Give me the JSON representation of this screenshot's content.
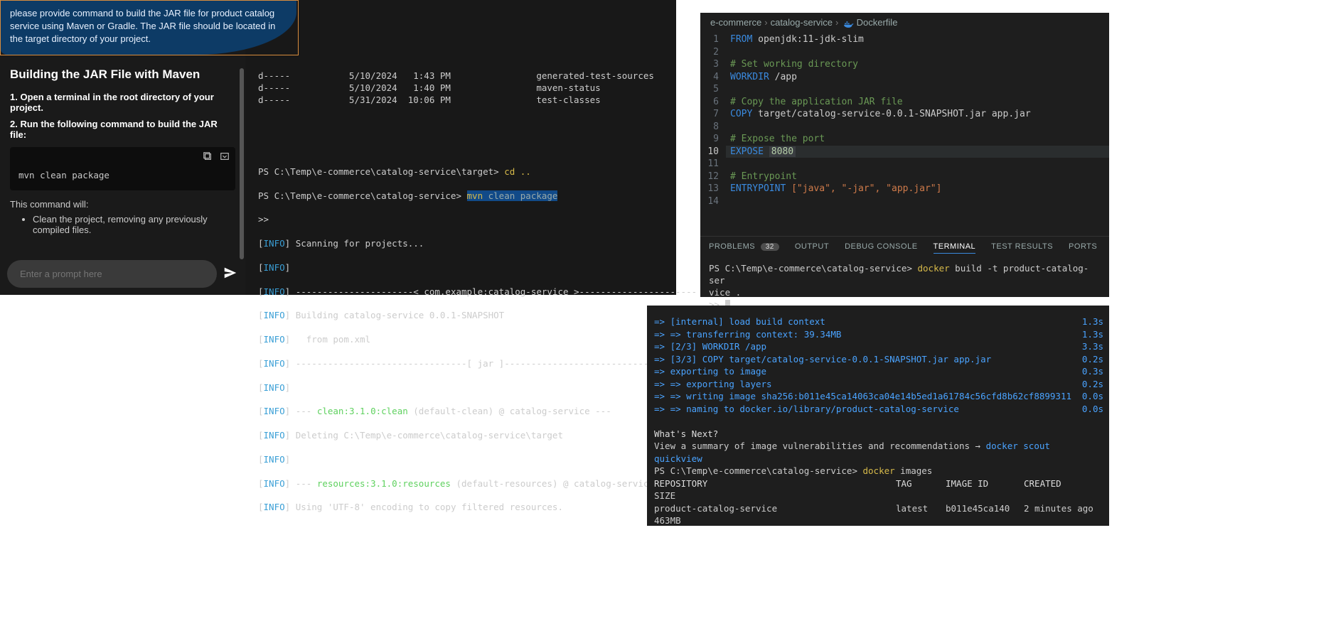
{
  "chat": {
    "callout": "please provide command to build the JAR file for product catalog service using Maven or Gradle. The JAR file should be located in the target directory of your project.",
    "heading": "Building the JAR File with Maven",
    "step1": "1. Open a terminal in the root directory of your project.",
    "step2": "2. Run the following command to build the JAR file:",
    "code": "mvn clean package",
    "will": "This command will:",
    "bullet1": "Clean the project, removing any previously compiled files.",
    "placeholder": "Enter a prompt here"
  },
  "term1": {
    "dir_listing": [
      {
        "mode": "d-----",
        "date": "5/10/2024",
        "time": "1:43 PM",
        "name": "generated-test-sources"
      },
      {
        "mode": "d-----",
        "date": "5/10/2024",
        "time": "1:40 PM",
        "name": "maven-status"
      },
      {
        "mode": "d-----",
        "date": "5/31/2024",
        "time": "10:06 PM",
        "name": "test-classes"
      }
    ],
    "ps1_path": "PS C:\\Temp\\e-commerce\\catalog-service\\target>",
    "cmd1": "cd ..",
    "ps2_path": "PS C:\\Temp\\e-commerce\\catalog-service>",
    "cmd2": "mvn clean package",
    "chev": ">>",
    "l_scan": "Scanning for projects...",
    "l_dash_art": "----------------------< com.example:catalog-service >----------------------",
    "l_build": "Building catalog-service 0.0.1-SNAPSHOT",
    "l_from": "  from pom.xml",
    "l_jar_dash": "--------------------------------[ jar ]---------------------------------",
    "l_clean_pre": "--- ",
    "l_clean_plug": "clean:3.1.0:clean",
    "l_clean_post": " (default-clean) @ catalog-service ---",
    "l_del": "Deleting C:\\Temp\\e-commerce\\catalog-service\\target",
    "l_res_plug": "resources:3.1.0:resources",
    "l_res_post": " (default-resources) @ catalog-service ---",
    "l_utf": "Using 'UTF-8' encoding to copy filtered resources."
  },
  "editor": {
    "crumb1": "e-commerce",
    "crumb2": "catalog-service",
    "crumb3": "Dockerfile",
    "lines": [
      {
        "n": 1,
        "kw": "FROM",
        "rest": " openjdk:11-jdk-slim"
      },
      {
        "n": 2,
        "rest": ""
      },
      {
        "n": 3,
        "cmt": "# Set working directory"
      },
      {
        "n": 4,
        "kw": "WORKDIR",
        "rest": " /app"
      },
      {
        "n": 5,
        "rest": ""
      },
      {
        "n": 6,
        "cmt": "# Copy the application JAR file"
      },
      {
        "n": 7,
        "kw": "COPY",
        "rest": " target/catalog-service-0.0.1-SNAPSHOT.jar app.jar"
      },
      {
        "n": 8,
        "rest": ""
      },
      {
        "n": 9,
        "cmt": "# Expose the port"
      },
      {
        "n": 10,
        "hl": true,
        "kw": "EXPOSE",
        "num": "8080"
      },
      {
        "n": 11,
        "rest": ""
      },
      {
        "n": 12,
        "cmt": "# Entrypoint"
      },
      {
        "n": 13,
        "kw": "ENTRYPOINT",
        "str": " [\"java\", \"-jar\", \"app.jar\"]"
      },
      {
        "n": 14,
        "rest": ""
      }
    ]
  },
  "tabs": {
    "problems": "PROBLEMS",
    "problems_count": "32",
    "output": "OUTPUT",
    "debug": "DEBUG CONSOLE",
    "terminal": "TERMINAL",
    "test": "TEST RESULTS",
    "ports": "PORTS"
  },
  "term2": {
    "prompt": "PS C:\\Temp\\e-commerce\\catalog-service> ",
    "docker": "docker",
    "rest": " build -t product-catalog-ser",
    "wrap": "vice .",
    "chev": ">> "
  },
  "docker": {
    "steps": [
      {
        "t": "=> [internal] load build context",
        "d": "1.3s"
      },
      {
        "t": "=> => transferring context: 39.34MB",
        "d": "1.3s"
      },
      {
        "t": "=> [2/3] WORKDIR /app",
        "d": "3.3s"
      },
      {
        "t": "=> [3/3] COPY target/catalog-service-0.0.1-SNAPSHOT.jar app.jar",
        "d": "0.2s"
      },
      {
        "t": "=> exporting to image",
        "d": "0.3s"
      },
      {
        "t": "=> => exporting layers",
        "d": "0.2s"
      },
      {
        "t": "=> => writing image sha256:b011e45ca14063ca04e14b5ed1a61784c56cfd8b62cf8899311",
        "d": "0.0s"
      },
      {
        "t": "=> => naming to docker.io/library/product-catalog-service",
        "d": "0.0s"
      }
    ],
    "whats_next": "What's Next?",
    "scout_line": "  View a summary of image vulnerabilities and recommendations → ",
    "scout_cmd": "docker scout quickview",
    "prompt": "PS C:\\Temp\\e-commerce\\catalog-service> ",
    "docker_kw": "docker",
    "images_cmd": " images",
    "headers": {
      "repo": "REPOSITORY",
      "tag": "TAG",
      "id": "IMAGE ID",
      "created": "CREATED",
      "size": "   SIZE"
    },
    "row": {
      "repo": "product-catalog-service",
      "tag": "latest",
      "id": "b011e45ca140",
      "created": "2 minutes ago",
      "size": "   463MB"
    }
  }
}
